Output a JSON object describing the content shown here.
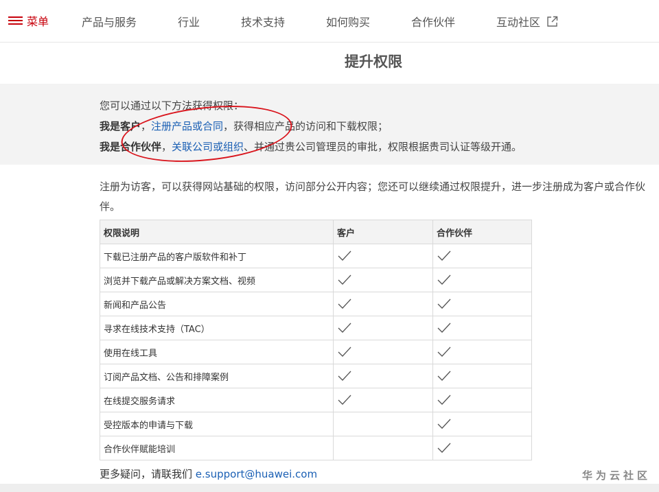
{
  "nav": {
    "menu_label": "菜单",
    "items": [
      "产品与服务",
      "行业",
      "技术支持",
      "如何购买",
      "合作伙伴",
      "互动社区"
    ]
  },
  "page": {
    "title": "提升权限"
  },
  "methods": {
    "intro": "您可以通过以下方法获得权限：",
    "customer_label": "我是客户",
    "customer_link": "注册产品或合同",
    "customer_text": "，获得相应产品的访问和下载权限；",
    "partner_label": "我是合作伙伴",
    "partner_link": "关联公司或组织",
    "partner_text": "、并通过贵公司管理员的审批，权限根据贵司认证等级开通。"
  },
  "intro_text": "注册为访客，可以获得网站基础的权限，访问部分公开内容；您还可以继续通过权限提升，进一步注册成为客户或合作伙伴。",
  "table": {
    "headers": [
      "权限说明",
      "客户",
      "合作伙伴"
    ],
    "rows": [
      {
        "label": "下载已注册产品的客户版软件和补丁",
        "customer": true,
        "partner": true
      },
      {
        "label": "浏览并下载产品或解决方案文档、视频",
        "customer": true,
        "partner": true
      },
      {
        "label": "新闻和产品公告",
        "customer": true,
        "partner": true
      },
      {
        "label": "寻求在线技术支持（TAC）",
        "customer": true,
        "partner": true
      },
      {
        "label": "使用在线工具",
        "customer": true,
        "partner": true
      },
      {
        "label": "订阅产品文档、公告和排障案例",
        "customer": true,
        "partner": true
      },
      {
        "label": "在线提交服务请求",
        "customer": true,
        "partner": true
      },
      {
        "label": "受控版本的申请与下载",
        "customer": false,
        "partner": true
      },
      {
        "label": "合作伙伴赋能培训",
        "customer": false,
        "partner": true
      }
    ]
  },
  "footer": {
    "text": "更多疑问，请联我们",
    "email": "e.support@huawei.com"
  },
  "watermark": "华为云社区",
  "colors": {
    "brand_red": "#c7000b",
    "link_blue": "#1a5fb4"
  }
}
